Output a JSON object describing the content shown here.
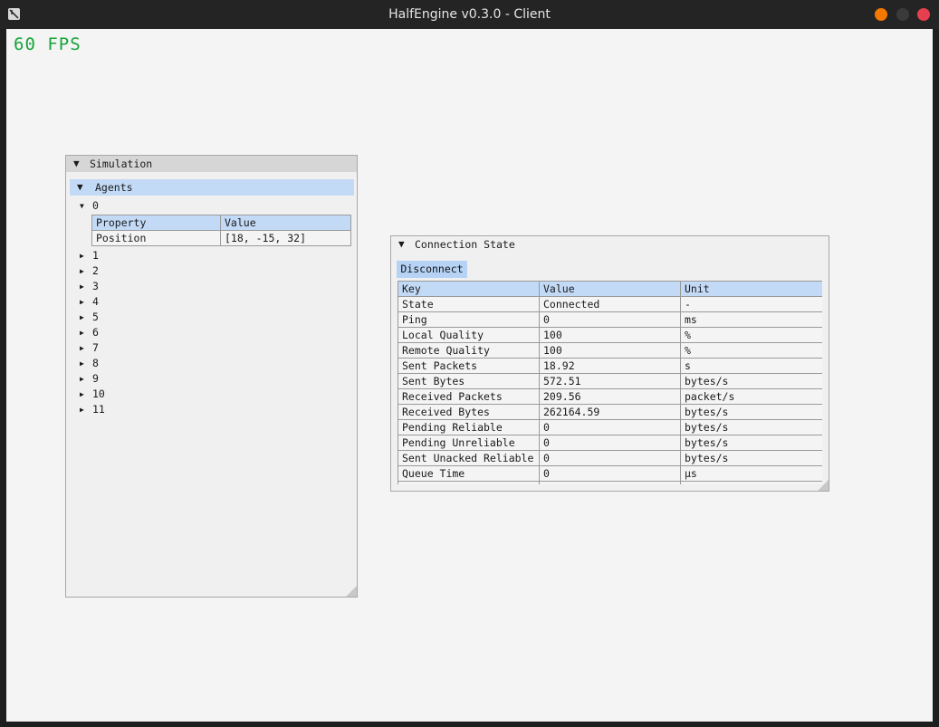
{
  "window": {
    "title": "HalfEngine v0.3.0 - Client"
  },
  "overlay": {
    "fps": "60 FPS"
  },
  "simulation": {
    "title": "Simulation",
    "agents_label": "Agents",
    "expanded_agent": "0",
    "property_table": {
      "headers": [
        "Property",
        "Value"
      ],
      "rows": [
        [
          "Position",
          "[18, -15, 32]"
        ]
      ]
    },
    "collapsed_agents": [
      "1",
      "2",
      "3",
      "4",
      "5",
      "6",
      "7",
      "8",
      "9",
      "10",
      "11"
    ]
  },
  "connection": {
    "title": "Connection State",
    "disconnect_label": "Disconnect",
    "headers": [
      "Key",
      "Value",
      "Unit"
    ],
    "rows": [
      [
        "State",
        "Connected",
        "-"
      ],
      [
        "Ping",
        "0",
        "ms"
      ],
      [
        "Local Quality",
        "100",
        "%"
      ],
      [
        "Remote Quality",
        "100",
        "%"
      ],
      [
        "Sent Packets",
        "18.92",
        "s"
      ],
      [
        "Sent Bytes",
        "572.51",
        "bytes/s"
      ],
      [
        "Received Packets",
        "209.56",
        "packet/s"
      ],
      [
        "Received Bytes",
        "262164.59",
        "bytes/s"
      ],
      [
        "Pending Reliable",
        "0",
        "bytes/s"
      ],
      [
        "Pending Unreliable",
        "0",
        "bytes/s"
      ],
      [
        "Sent Unacked Reliable",
        "0",
        "bytes/s"
      ],
      [
        "Queue Time",
        "0",
        "µs"
      ]
    ]
  },
  "icons": {
    "collapse": "triangle-down-icon",
    "expand": "triangle-right-icon"
  },
  "colors": {
    "fps": "#16a33a",
    "header_highlight": "#c3daf7",
    "close": "#e5404f",
    "minimize": "#f57900"
  }
}
